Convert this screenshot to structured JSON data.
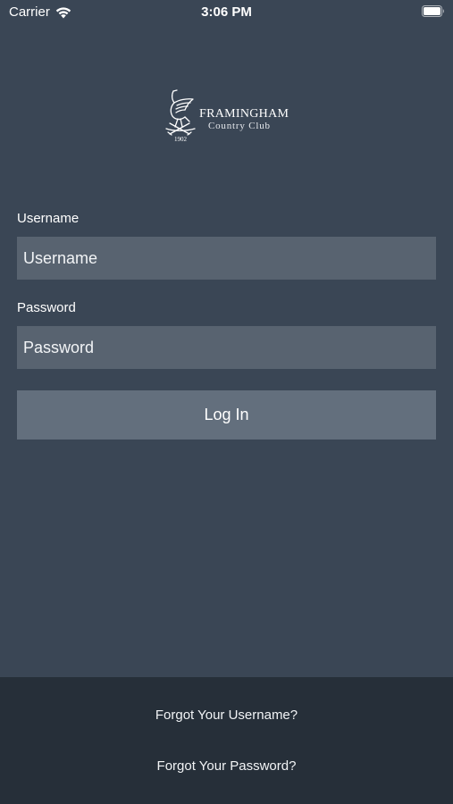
{
  "status_bar": {
    "carrier": "Carrier",
    "time": "3:06 PM",
    "wifi_icon": "wifi-icon",
    "battery_icon": "battery-icon"
  },
  "logo": {
    "line1": "FRAMINGHAM",
    "line2": "Country Club",
    "year": "1902",
    "emblem_icon": "heron-golf-emblem"
  },
  "form": {
    "username_label": "Username",
    "username_placeholder": "Username",
    "username_value": "",
    "password_label": "Password",
    "password_placeholder": "Password",
    "password_value": "",
    "login_label": "Log In"
  },
  "footer": {
    "forgot_username": "Forgot Your Username?",
    "forgot_password": "Forgot Your Password?"
  },
  "colors": {
    "background": "#3a4655",
    "input_background": "#586370",
    "button_background": "#636f7d",
    "footer_background": "#262f39",
    "text": "#ffffff"
  }
}
